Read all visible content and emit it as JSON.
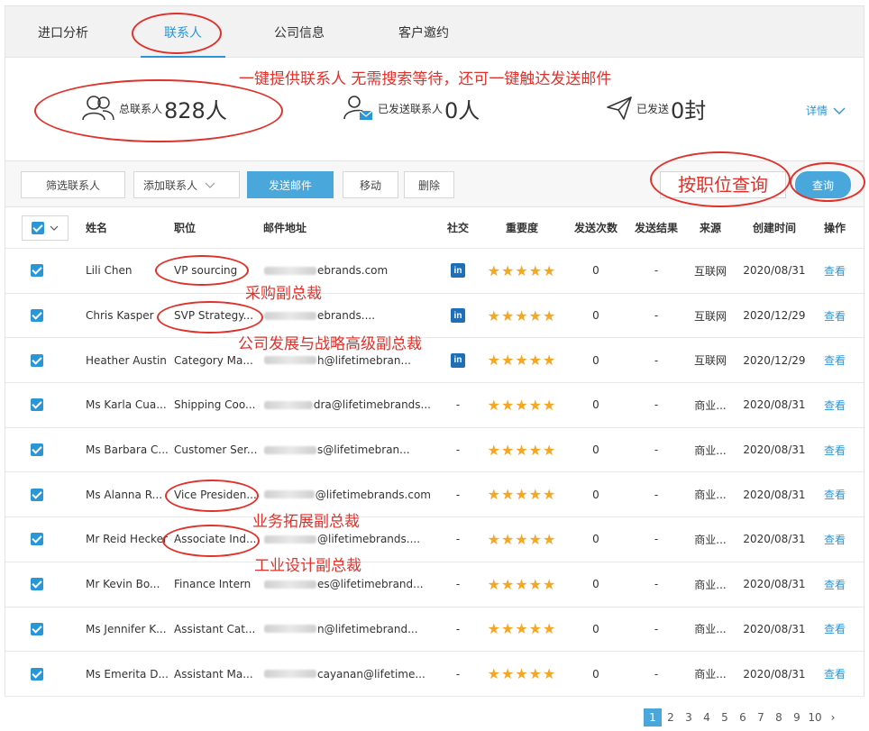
{
  "tabs": [
    {
      "label": "进口分析"
    },
    {
      "label": "联系人"
    },
    {
      "label": "公司信息"
    },
    {
      "label": "客户邀约"
    }
  ],
  "stats": {
    "total_label": "总联系人",
    "total_value": "828人",
    "sent_contacts_label": "已发送联系人",
    "sent_contacts_value": "0人",
    "sent_label": "已发送",
    "sent_value": "0封",
    "details_label": "详情"
  },
  "toolbar": {
    "filter": "筛选联系人",
    "add": "添加联系人",
    "send": "发送邮件",
    "move": "移动",
    "delete": "删除",
    "query": "查询"
  },
  "columns": [
    "姓名",
    "职位",
    "邮件地址",
    "社交",
    "重要度",
    "发送次数",
    "发送结果",
    "来源",
    "创建时间",
    "操作"
  ],
  "rows": [
    {
      "name": "Lili Chen",
      "title": "VP sourcing",
      "email": "ebrands.com",
      "social": "in",
      "stars": "★★★★★",
      "sends": "0",
      "result": "-",
      "source": "互联网",
      "created": "2020/08/31",
      "action": "查看"
    },
    {
      "name": "Chris Kasper",
      "title": "SVP Strategy...",
      "email": "ebrands....",
      "social": "in",
      "stars": "★★★★★",
      "sends": "0",
      "result": "-",
      "source": "互联网",
      "created": "2020/12/29",
      "action": "查看"
    },
    {
      "name": "Heather Austin",
      "title": "Category Ma...",
      "email": "h@lifetimebran...",
      "social": "in",
      "stars": "★★★★★",
      "sends": "0",
      "result": "-",
      "source": "互联网",
      "created": "2020/12/29",
      "action": "查看"
    },
    {
      "name": "Ms Karla Cua...",
      "title": "Shipping Coo...",
      "email": "dra@lifetimebrands...",
      "social": "-",
      "stars": "★★★★★",
      "sends": "0",
      "result": "-",
      "source": "商业...",
      "created": "2020/08/31",
      "action": "查看"
    },
    {
      "name": "Ms Barbara C...",
      "title": "Customer Ser...",
      "email": "s@lifetimebran...",
      "social": "-",
      "stars": "★★★★★",
      "sends": "0",
      "result": "-",
      "source": "商业...",
      "created": "2020/08/31",
      "action": "查看"
    },
    {
      "name": "Ms Alanna R...",
      "title": "Vice Presiden...",
      "email": "@lifetimebrands.com",
      "social": "-",
      "stars": "★★★★★",
      "sends": "0",
      "result": "-",
      "source": "商业...",
      "created": "2020/08/31",
      "action": "查看"
    },
    {
      "name": "Mr Reid Hecker",
      "title": "Associate Ind...",
      "email": "@lifetimebrands....",
      "social": "-",
      "stars": "★★★★★",
      "sends": "0",
      "result": "-",
      "source": "商业...",
      "created": "2020/08/31",
      "action": "查看"
    },
    {
      "name": "Mr Kevin Bo...",
      "title": "Finance Intern",
      "email": "es@lifetimebrand...",
      "social": "-",
      "stars": "★★★★★",
      "sends": "0",
      "result": "-",
      "source": "商业...",
      "created": "2020/08/31",
      "action": "查看"
    },
    {
      "name": "Ms Jennifer K...",
      "title": "Assistant Cat...",
      "email": "n@lifetimebrand...",
      "social": "-",
      "stars": "★★★★★",
      "sends": "0",
      "result": "-",
      "source": "商业...",
      "created": "2020/08/31",
      "action": "查看"
    },
    {
      "name": "Ms Emerita D...",
      "title": "Assistant Ma...",
      "email": "cayanan@lifetime...",
      "social": "-",
      "stars": "★★★★★",
      "sends": "0",
      "result": "-",
      "source": "商业...",
      "created": "2020/08/31",
      "action": "查看"
    }
  ],
  "pagination": [
    "1",
    "2",
    "3",
    "4",
    "5",
    "6",
    "7",
    "8",
    "9",
    "10",
    "›"
  ],
  "annotations": {
    "top": "一键提供联系人 无需搜索等待，还可一键触达发送邮件",
    "query_by_title": "按职位查询",
    "vp_sourcing": "采购副总裁",
    "svp_strategy": "公司发展与战略高级副总裁",
    "vp_biz": "业务拓展副总裁",
    "vp_design": "工业设计副总裁"
  },
  "colors": {
    "accent": "#2a96d6",
    "annotation": "#e0312b",
    "star": "#f5a623",
    "linkedin": "#1d6fb8"
  }
}
